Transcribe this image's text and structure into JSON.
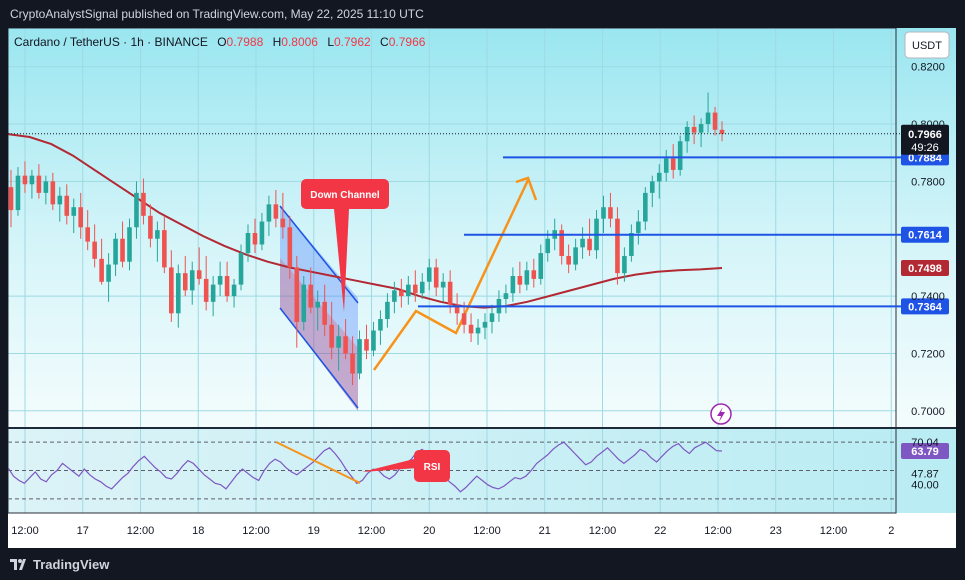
{
  "header": {
    "publisher_line": "CryptoAnalystSignal published on TradingView.com, May 22, 2025 11:10 UTC"
  },
  "symbol": {
    "name": "Cardano / TetherUS · 1h · BINANCE",
    "o_label": "O",
    "o": "0.7988",
    "h_label": "H",
    "h": "0.8006",
    "l_label": "L",
    "l": "0.7962",
    "c_label": "C",
    "c": "0.7966"
  },
  "currency_button": "USDT",
  "footer": {
    "brand": "TradingView",
    "brand_icon": "tradingview-logo-icon"
  },
  "colors": {
    "up": "#26a69a",
    "down": "#ef5350",
    "level_line": "#1e53e5",
    "ma": "#b22833",
    "rsi": "#7e57c2",
    "arrow": "#f7931a",
    "badge_red": "#f23645"
  },
  "chart_data": [
    {
      "type": "candlestick",
      "title": "",
      "ylim": [
        0.694,
        0.8335
      ],
      "y_ticks": [
        "0.8200",
        "0.8000",
        "0.7800",
        "0.7400",
        "0.7200",
        "0.7000"
      ],
      "x_ticks": [
        "12:00",
        "17",
        "12:00",
        "18",
        "12:00",
        "19",
        "12:00",
        "20",
        "12:00",
        "21",
        "12:00",
        "22",
        "12:00",
        "23",
        "12:00",
        "2"
      ],
      "last_price": {
        "value": "0.7966",
        "countdown": "49:26"
      },
      "levels": [
        {
          "label": "0.7884",
          "value": 0.7884
        },
        {
          "label": "0.7614",
          "value": 0.7614
        },
        {
          "label": "0.7364",
          "value": 0.7364
        }
      ],
      "ma_label": "0.7498",
      "annotations": {
        "down_channel": "Down Channel"
      },
      "candles": [
        [
          0.778,
          0.784,
          0.764,
          0.77
        ],
        [
          0.77,
          0.785,
          0.768,
          0.782
        ],
        [
          0.782,
          0.787,
          0.776,
          0.779
        ],
        [
          0.779,
          0.784,
          0.774,
          0.782
        ],
        [
          0.782,
          0.786,
          0.774,
          0.776
        ],
        [
          0.776,
          0.782,
          0.772,
          0.78
        ],
        [
          0.78,
          0.783,
          0.77,
          0.772
        ],
        [
          0.772,
          0.778,
          0.766,
          0.775
        ],
        [
          0.775,
          0.779,
          0.765,
          0.768
        ],
        [
          0.768,
          0.774,
          0.762,
          0.771
        ],
        [
          0.771,
          0.776,
          0.76,
          0.764
        ],
        [
          0.764,
          0.77,
          0.756,
          0.759
        ],
        [
          0.759,
          0.765,
          0.75,
          0.753
        ],
        [
          0.753,
          0.76,
          0.744,
          0.745
        ],
        [
          0.745,
          0.755,
          0.738,
          0.751
        ],
        [
          0.751,
          0.762,
          0.747,
          0.76
        ],
        [
          0.76,
          0.766,
          0.75,
          0.752
        ],
        [
          0.752,
          0.767,
          0.749,
          0.764
        ],
        [
          0.764,
          0.78,
          0.76,
          0.776
        ],
        [
          0.776,
          0.781,
          0.765,
          0.768
        ],
        [
          0.768,
          0.772,
          0.757,
          0.76
        ],
        [
          0.76,
          0.766,
          0.752,
          0.763
        ],
        [
          0.763,
          0.768,
          0.748,
          0.75
        ],
        [
          0.75,
          0.756,
          0.731,
          0.734
        ],
        [
          0.734,
          0.751,
          0.729,
          0.748
        ],
        [
          0.748,
          0.754,
          0.74,
          0.742
        ],
        [
          0.742,
          0.752,
          0.737,
          0.749
        ],
        [
          0.749,
          0.757,
          0.744,
          0.746
        ],
        [
          0.746,
          0.754,
          0.735,
          0.738
        ],
        [
          0.738,
          0.747,
          0.733,
          0.744
        ],
        [
          0.744,
          0.752,
          0.74,
          0.747
        ],
        [
          0.747,
          0.752,
          0.738,
          0.74
        ],
        [
          0.74,
          0.746,
          0.736,
          0.744
        ],
        [
          0.744,
          0.758,
          0.742,
          0.755
        ],
        [
          0.755,
          0.765,
          0.752,
          0.762
        ],
        [
          0.762,
          0.767,
          0.755,
          0.758
        ],
        [
          0.758,
          0.769,
          0.756,
          0.766
        ],
        [
          0.766,
          0.775,
          0.761,
          0.772
        ],
        [
          0.772,
          0.777,
          0.764,
          0.767
        ],
        [
          0.767,
          0.776,
          0.76,
          0.764
        ],
        [
          0.764,
          0.768,
          0.746,
          0.75
        ],
        [
          0.75,
          0.754,
          0.722,
          0.731
        ],
        [
          0.731,
          0.747,
          0.728,
          0.744
        ],
        [
          0.744,
          0.75,
          0.734,
          0.736
        ],
        [
          0.736,
          0.742,
          0.728,
          0.738
        ],
        [
          0.738,
          0.744,
          0.726,
          0.73
        ],
        [
          0.73,
          0.738,
          0.718,
          0.722
        ],
        [
          0.722,
          0.73,
          0.714,
          0.726
        ],
        [
          0.726,
          0.732,
          0.718,
          0.72
        ],
        [
          0.72,
          0.726,
          0.709,
          0.713
        ],
        [
          0.713,
          0.728,
          0.711,
          0.725
        ],
        [
          0.725,
          0.73,
          0.718,
          0.721
        ],
        [
          0.721,
          0.731,
          0.719,
          0.728
        ],
        [
          0.728,
          0.735,
          0.723,
          0.732
        ],
        [
          0.732,
          0.741,
          0.729,
          0.738
        ],
        [
          0.738,
          0.745,
          0.734,
          0.742
        ],
        [
          0.742,
          0.746,
          0.736,
          0.74
        ],
        [
          0.74,
          0.747,
          0.737,
          0.744
        ],
        [
          0.744,
          0.749,
          0.738,
          0.741
        ],
        [
          0.741,
          0.748,
          0.739,
          0.745
        ],
        [
          0.745,
          0.753,
          0.742,
          0.75
        ],
        [
          0.75,
          0.753,
          0.74,
          0.743
        ],
        [
          0.743,
          0.748,
          0.738,
          0.745
        ],
        [
          0.745,
          0.749,
          0.734,
          0.737
        ],
        [
          0.737,
          0.741,
          0.73,
          0.734
        ],
        [
          0.734,
          0.738,
          0.727,
          0.73
        ],
        [
          0.73,
          0.734,
          0.724,
          0.727
        ],
        [
          0.727,
          0.732,
          0.723,
          0.729
        ],
        [
          0.729,
          0.734,
          0.725,
          0.731
        ],
        [
          0.731,
          0.737,
          0.727,
          0.734
        ],
        [
          0.734,
          0.742,
          0.731,
          0.739
        ],
        [
          0.739,
          0.744,
          0.734,
          0.741
        ],
        [
          0.741,
          0.75,
          0.738,
          0.747
        ],
        [
          0.747,
          0.752,
          0.741,
          0.744
        ],
        [
          0.744,
          0.752,
          0.742,
          0.749
        ],
        [
          0.749,
          0.753,
          0.743,
          0.746
        ],
        [
          0.746,
          0.758,
          0.744,
          0.755
        ],
        [
          0.755,
          0.763,
          0.752,
          0.76
        ],
        [
          0.76,
          0.767,
          0.756,
          0.763
        ],
        [
          0.763,
          0.765,
          0.751,
          0.754
        ],
        [
          0.754,
          0.758,
          0.748,
          0.751
        ],
        [
          0.751,
          0.76,
          0.749,
          0.757
        ],
        [
          0.757,
          0.764,
          0.753,
          0.76
        ],
        [
          0.76,
          0.767,
          0.754,
          0.756
        ],
        [
          0.756,
          0.77,
          0.753,
          0.767
        ],
        [
          0.767,
          0.775,
          0.762,
          0.771
        ],
        [
          0.771,
          0.776,
          0.764,
          0.767
        ],
        [
          0.767,
          0.771,
          0.744,
          0.748
        ],
        [
          0.748,
          0.757,
          0.745,
          0.754
        ],
        [
          0.754,
          0.765,
          0.752,
          0.762
        ],
        [
          0.762,
          0.77,
          0.758,
          0.766
        ],
        [
          0.766,
          0.778,
          0.763,
          0.776
        ],
        [
          0.776,
          0.782,
          0.771,
          0.78
        ],
        [
          0.78,
          0.786,
          0.774,
          0.783
        ],
        [
          0.783,
          0.791,
          0.78,
          0.788
        ],
        [
          0.788,
          0.793,
          0.781,
          0.784
        ],
        [
          0.784,
          0.796,
          0.782,
          0.794
        ],
        [
          0.794,
          0.801,
          0.79,
          0.799
        ],
        [
          0.799,
          0.803,
          0.793,
          0.797
        ],
        [
          0.797,
          0.802,
          0.792,
          0.8
        ],
        [
          0.8,
          0.811,
          0.797,
          0.804
        ],
        [
          0.804,
          0.806,
          0.796,
          0.798
        ],
        [
          0.798,
          0.801,
          0.794,
          0.7966
        ]
      ],
      "ma": [
        0.7965,
        0.7955,
        0.793,
        0.789,
        0.784,
        0.779,
        0.774,
        0.769,
        0.765,
        0.761,
        0.7575,
        0.7545,
        0.752,
        0.75,
        0.7485,
        0.747,
        0.7455,
        0.744,
        0.7425,
        0.74,
        0.738,
        0.7365,
        0.736,
        0.7365,
        0.738,
        0.74,
        0.742,
        0.744,
        0.746,
        0.7475,
        0.7485,
        0.749,
        0.7493,
        0.7498
      ]
    },
    {
      "type": "line",
      "title": "",
      "ylim": [
        20,
        80
      ],
      "y_ticks": [
        "70.04",
        "47.87",
        "40.00"
      ],
      "last_label": "63.79",
      "annotations": {
        "rsi_badge": "RSI"
      },
      "values": [
        52,
        46,
        43,
        41,
        45,
        49,
        44,
        42,
        47,
        50,
        55,
        52,
        49,
        46,
        51,
        47,
        44,
        42,
        39,
        37,
        41,
        45,
        48,
        53,
        57,
        60,
        56,
        52,
        49,
        45,
        44,
        48,
        53,
        57,
        55,
        51,
        47,
        44,
        41,
        40,
        37,
        42,
        47,
        51,
        48,
        45,
        43,
        50,
        55,
        58,
        56,
        52,
        49,
        47,
        50,
        53,
        56,
        60,
        64,
        66,
        62,
        57,
        51,
        46,
        41,
        43,
        48,
        51,
        50,
        46,
        44,
        47,
        52,
        55,
        58,
        63,
        65,
        61,
        57,
        52,
        46,
        42,
        39,
        35,
        38,
        42,
        46,
        43,
        40,
        38,
        37,
        39,
        42,
        45,
        44,
        46,
        50,
        55,
        58,
        61,
        65,
        68,
        70,
        66,
        62,
        58,
        54,
        56,
        60,
        63,
        66,
        62,
        58,
        55,
        58,
        61,
        65,
        63,
        59,
        56,
        60,
        64,
        67,
        69,
        65,
        62,
        66,
        68,
        70,
        67,
        64,
        63.79
      ]
    }
  ]
}
